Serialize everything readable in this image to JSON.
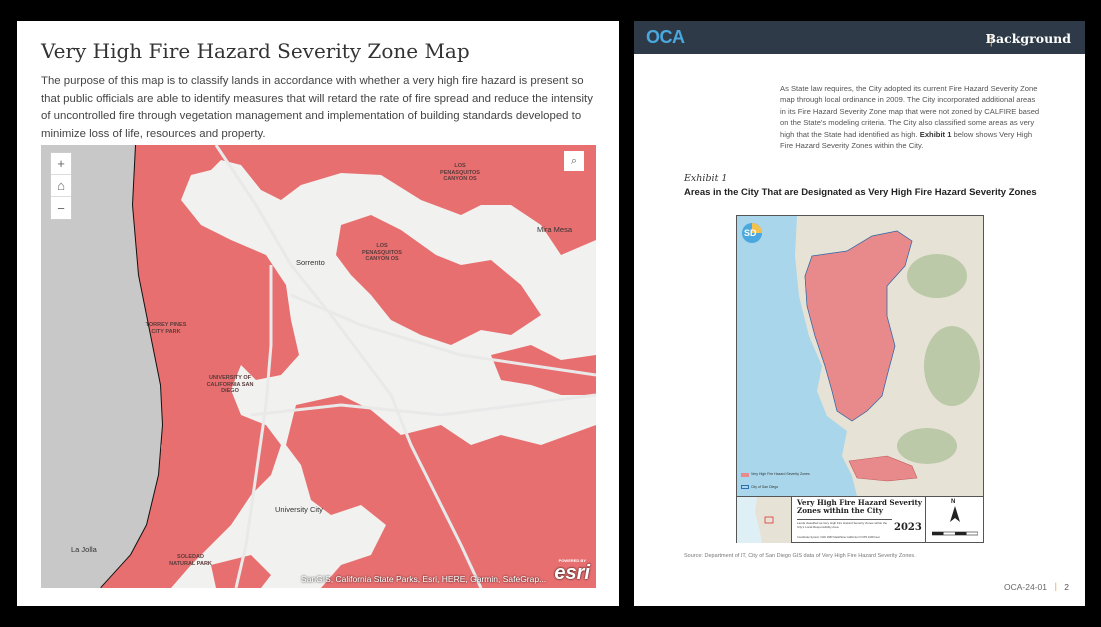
{
  "left": {
    "title": "Very High Fire Hazard Severity Zone Map",
    "description": "The purpose of this map is to classify lands in accordance with whether a very high fire hazard is present so that public officials are able to identify measures that will retard the rate of fire spread and reduce the intensity of uncontrolled fire through vegetation management and implementation of building standards developed to minimize loss of life, resources and property.",
    "map": {
      "controls": {
        "zoom_in": "+",
        "home": "⌂",
        "zoom_out": "−"
      },
      "search_icon": "search-icon",
      "labels": {
        "los_penasquitos_1": "LOS PENASQUITOS CANYON OS",
        "los_penasquitos_2": "LOS PENASQUITOS CANYON OS",
        "sorrento": "Sorrento",
        "mira_mesa": "Mira Mesa",
        "torrey_pines": "TORREY PINES CITY PARK",
        "ucsd": "UNIVERSITY OF CALIFORNIA SAN DIEGO",
        "university_city": "University City",
        "la_jolla": "La Jolla",
        "soledad": "SOLEDAD NATURAL PARK"
      },
      "attribution": "SanGIS, California State Parks, Esri, HERE, Garmin, SafeGrap...",
      "esri_powered": "POWERED BY",
      "esri_logo": "esri",
      "colors": {
        "hazard": "#e86f70",
        "ocean": "#c8c8c8",
        "land": "#f1f1ef"
      }
    }
  },
  "right": {
    "logo": "OCA",
    "header_title": "Background",
    "body_part1": "As State law requires, the City adopted its current Fire Hazard Severity Zone map through local ordinance in 2009. The City incorporated additional areas in its Fire Hazard Severity Zone map that were not zoned by CALFIRE based on the State's modeling criteria. The City also classified some areas as very high that the State had identified as high.",
    "body_bold": "Exhibit 1",
    "body_part2": " below shows Very High Fire Hazard Severity Zones within the City.",
    "exhibit_label": "Exhibit 1",
    "exhibit_title": "Areas in the City That are Designated as Very High Fire Hazard Severity Zones",
    "exhibit_map": {
      "logo": "SD",
      "legend_vh": "Very High Fire Hazard Severity Zones",
      "legend_city": "City of San Diego",
      "title_block": {
        "title": "Very High Fire Hazard Severity Zones within the City",
        "subtitle": "Lands classified as Very High Fire Hazard Severity Zones within the City's Local Responsibility Area",
        "year": "2023",
        "coord": "Coordinate System: NAD 1983 StatePlane California VI FIPS 0406 Feet",
        "north": "N"
      },
      "colors": {
        "hazard": "#e88a8c",
        "ocean": "#a9d6ea",
        "land": "#e6e3d6",
        "header": "#2e3a48",
        "accent": "#e6a23c",
        "logo": "#4aa8de"
      }
    },
    "source": "Source: Department of IT, City of San Diego GIS data of Very High Fire Hazard Severity Zones.",
    "footer_code": "OCA-24-01",
    "footer_page": "2"
  }
}
